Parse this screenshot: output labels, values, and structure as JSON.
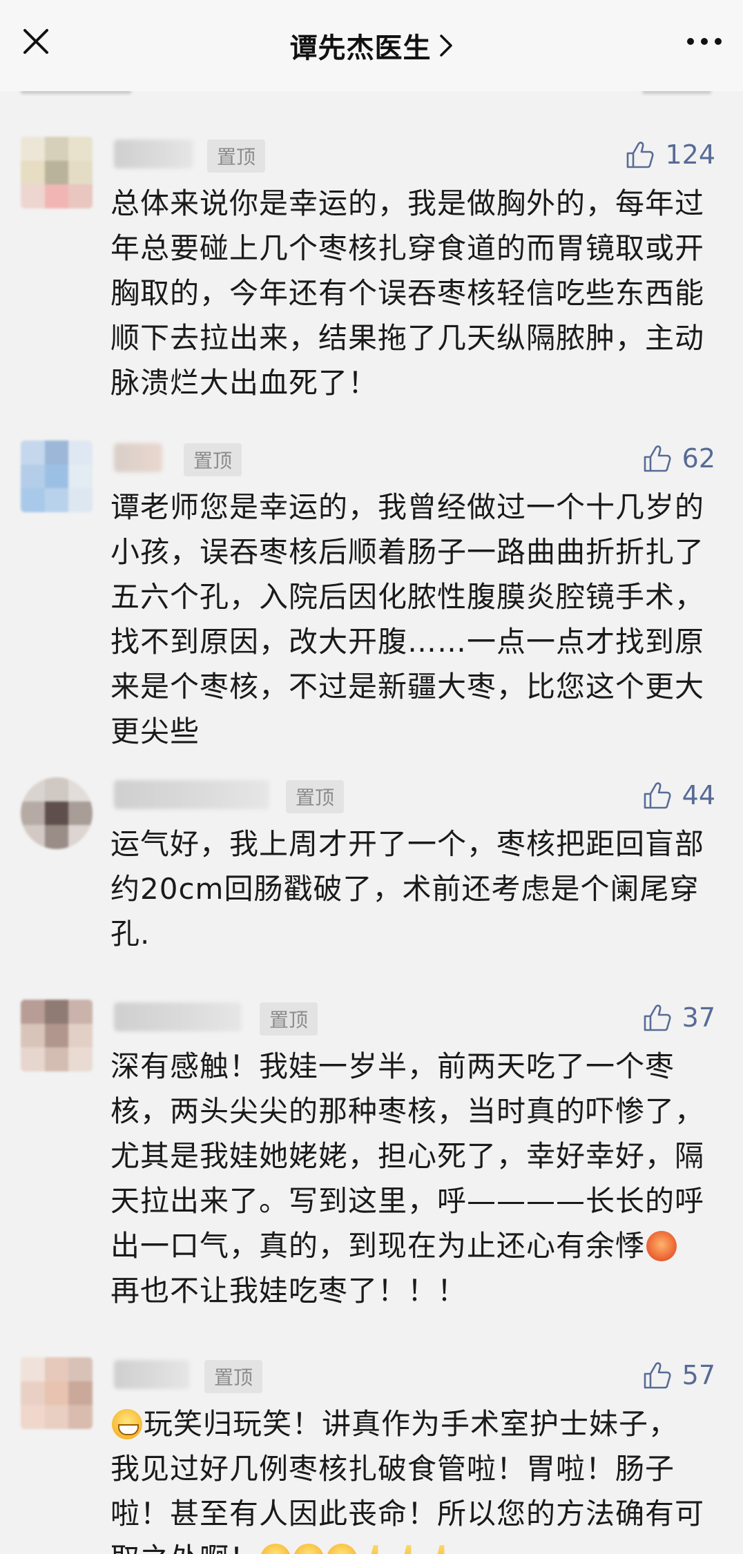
{
  "nav": {
    "title": "谭先杰医生",
    "close_icon": "close-icon",
    "chevron_icon": "chevron-right-icon",
    "more_icon": "more-icon"
  },
  "pin_label": "置顶",
  "colors": {
    "link_blue": "#576b95",
    "background": "#f2f2f2",
    "pin_bg": "#e3e3e3"
  },
  "comments": [
    {
      "likes": "124",
      "text": "总体来说你是幸运的，我是做胸外的，每年过年总要碰上几个枣核扎穿食道的而胃镜取或开胸取的，今年还有个误吞枣核轻信吃些东西能顺下去拉出来，结果拖了几天纵隔脓肿，主动脉溃烂大出血死了！"
    },
    {
      "likes": "62",
      "text": "谭老师您是幸运的，我曾经做过一个十几岁的小孩，误吞枣核后顺着肠子一路曲曲折折扎了五六个孔，入院后因化脓性腹膜炎腔镜手术，找不到原因，改大开腹……一点一点才找到原来是个枣核，不过是新疆大枣，比您这个更大更尖些"
    },
    {
      "likes": "44",
      "text": "运气好，我上周才开了一个，枣核把距回盲部约20cm回肠戳破了，术前还考虑是个阑尾穿孔."
    },
    {
      "likes": "37",
      "text_before": "深有感触！我娃一岁半，前两天吃了一个枣核，两头尖尖的那种枣核，当时真的吓惨了，尤其是我娃她姥姥，担心死了，幸好幸好，隔天拉出来了。写到这里，呼————长长的呼出一口气，真的，到现在为止还心有余悸",
      "emoji": "angry-face-emoji",
      "text_after": "再也不让我娃吃枣了！！！"
    },
    {
      "likes": "57",
      "emoji_lead": "grinning-face-emoji",
      "text": "玩笑归玩笑！讲真作为手术室护士妹子，我见过好几例枣核扎破食管啦！胃啦！肠子啦！甚至有人因此丧命！所以您的方法确有可取之处啊！",
      "emoji_tail": [
        "hugging-face-emoji",
        "hugging-face-emoji",
        "hugging-face-emoji",
        "thumbs-up-emoji",
        "thumbs-up-emoji",
        "thumbs-up-emoji"
      ]
    }
  ]
}
